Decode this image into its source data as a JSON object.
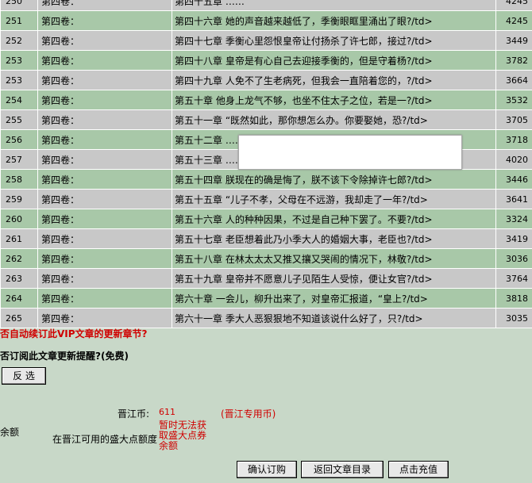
{
  "chapters": [
    {
      "num": "250",
      "volume": "第四卷：",
      "title": "第四十五章  ……",
      "count": "4245"
    },
    {
      "num": "251",
      "volume": "第四卷：",
      "title": "第四十六章  她的声音越来越低了，季衡眼眶里涌出了眼?/td>",
      "count": "4245"
    },
    {
      "num": "252",
      "volume": "第四卷：",
      "title": "第四十七章  季衡心里怨恨皇帝让付扬杀了许七郎，接过?/td>",
      "count": "3449"
    },
    {
      "num": "253",
      "volume": "第四卷：",
      "title": "第四十八章  皇帝是有心自己去迎接季衡的，但是守着杨?/td>",
      "count": "3782"
    },
    {
      "num": "253",
      "volume": "第四卷：",
      "title": "第四十九章  人免不了生老病死，但我会一直陪着您的，?/td>",
      "count": "3664"
    },
    {
      "num": "254",
      "volume": "第四卷：",
      "title": "第五十章  他身上龙气不够，也坐不住太子之位，若是一?/td>",
      "count": "3532"
    },
    {
      "num": "255",
      "volume": "第四卷：",
      "title": "第五十一章  “既然如此，那你想怎么办。你要娶她，恐?/td>",
      "count": "3705"
    },
    {
      "num": "256",
      "volume": "第四卷：",
      "title": "第五十二章  ……",
      "count": "3718"
    },
    {
      "num": "257",
      "volume": "第四卷：",
      "title": "第五十三章  ……",
      "count": "4020"
    },
    {
      "num": "258",
      "volume": "第四卷：",
      "title": "第五十四章  朕现在的确是悔了，朕不该下令除掉许七郎?/td>",
      "count": "3446"
    },
    {
      "num": "259",
      "volume": "第四卷：",
      "title": "第五十五章  “儿子不孝，父母在不远游，我却走了一年?/td>",
      "count": "3641"
    },
    {
      "num": "260",
      "volume": "第四卷：",
      "title": "第五十六章  人的种种因果，不过是自己种下罢了。不要?/td>",
      "count": "3324"
    },
    {
      "num": "261",
      "volume": "第四卷：",
      "title": "第五十七章  老臣想着此乃小季大人的婚姻大事，老臣也?/td>",
      "count": "3419"
    },
    {
      "num": "262",
      "volume": "第四卷：",
      "title": "第五十八章  在林太太太又推又攘又哭闹的情况下，林敬?/td>",
      "count": "3036"
    },
    {
      "num": "263",
      "volume": "第四卷：",
      "title": "第五十九章  皇帝并不愿意儿子见陌生人受惊，便让女官?/td>",
      "count": "3764"
    },
    {
      "num": "264",
      "volume": "第四卷：",
      "title": "第六十章  一会儿，柳升出来了，对皇帝汇报道，“皇上?/td>",
      "count": "3818"
    },
    {
      "num": "265",
      "volume": "第四卷：",
      "title": "第六十一章  季大人恶狠狠地不知道该说什么好了，只?/td>",
      "count": "3035"
    }
  ],
  "auto_subscribe_question": "否自动续订此VIP文章的更新章节?",
  "update_reminder_question": "否订阅此文章更新提醒?(免费)",
  "invert_select_label": "反 选",
  "jjb_label": "晋江币:",
  "jjb_value": "611",
  "jjb_note": "(晋江专用币)",
  "balance_label": "余额",
  "points_label": "在晋江可用的盛大点额度",
  "points_status": "暂时无法获取盛大点券余额",
  "confirm_label": "确认订购",
  "back_label": "返回文章目录",
  "recharge_label": "点击充值"
}
